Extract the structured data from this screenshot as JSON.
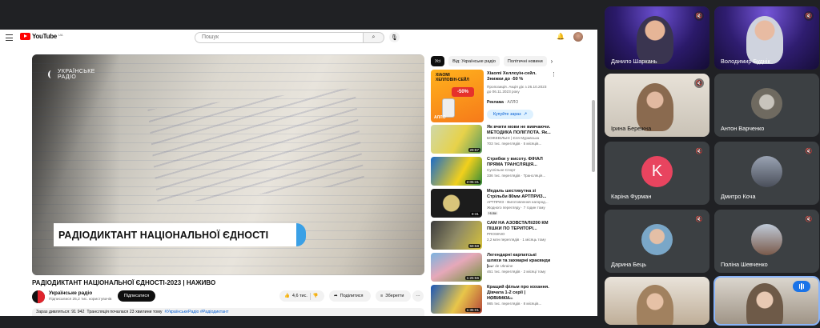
{
  "youtube": {
    "logo_text": "YouTube",
    "logo_country": "UA",
    "search_placeholder": "Пошук",
    "search_icon": "search-icon",
    "mic_icon": "mic-icon",
    "bell_icon": "bell-icon",
    "player": {
      "logo_line1": "УКРАЇНСЬКЕ",
      "logo_line2": "РАДІО",
      "banner": "РАДІОДИКТАНТ НАЦІОНАЛЬНОЇ ЄДНОСТІ"
    },
    "video_title": "РАДІОДИКТАНТ НАЦІОНАЛЬНОЇ ЄДНОСТІ-2023 | НАЖИВО",
    "channel": {
      "name": "Українське радіо",
      "subscribers": "Підписалися 25,2 тис. користувачів",
      "subscribe_label": "Підписатися"
    },
    "actions": {
      "likes": "4,6 тис.",
      "share": "Поділитися",
      "save": "Зберегти",
      "more": "···"
    },
    "description": {
      "watching": "Зараз дивляться: 91 942",
      "started": "Трансляція почалася 23 хвилини тому",
      "tags": "#УкраїнськеРадіо #Радіодиктант"
    },
    "chips": [
      "Усі",
      "Від: Українське радіо",
      "Політичні новини"
    ],
    "ad": {
      "thumb_line1": "XIAOMI",
      "thumb_line2": "ХЕЛЛОВІН-СЕЙЛ",
      "thumb_badge": "-50%",
      "thumb_brand": "АЛЛО",
      "title": "Xiaomi Хеллоуін-сейл. Знижки до -50 %",
      "meta": "Пропозиція. Акція діє з 26.10.2023 до 06.11.2023 року",
      "label_bold": "Реклама",
      "label_src": "· АЛЛО",
      "cta": "Купуйте зараз"
    },
    "recommendations": [
      {
        "title": "Як вчити мови не вивчаючи. МЕТОДИКА ПОЛІГЛОТА. Як...",
        "channel": "БОЖЕВІЛЬНІ | Єля Муравська",
        "meta": "703 тис. переглядів · 5 місяців...",
        "duration": "29:57",
        "badge": ""
      },
      {
        "title": "Стрибки у висоту. ФІНАЛ ПРЯМА ТРАНСЛЯЦІЯ...",
        "channel": "Суспільне Спорт",
        "meta": "336 тис. переглядів · Трансляція...",
        "duration": "2:05:31",
        "badge": ""
      },
      {
        "title": "Медаль шестикутна зі Стрільби 80мм АРТПРИЗ...",
        "channel": "АРТПРИЗ - Виготовлення нагород...",
        "meta": "Жодного перегляду · 7 годин тому",
        "duration": "8:31",
        "badge": "Нове"
      },
      {
        "title": "САМ НА АЗОВСТАЛІ/200 КМ ПІШКИ ПО ТЕРИТОРІ...",
        "channel": "PROSINIO",
        "meta": "2,2 млн переглядів · 1 місяць тому",
        "duration": "59:58",
        "badge": ""
      },
      {
        "title": "Легендарні карпатські шляхи та захмарні краєвиди |...",
        "channel": "Tour de Ukraine",
        "meta": "461 тис. переглядів · 2 місяці тому",
        "duration": "1:25:56",
        "badge": ""
      },
      {
        "title": "Кращий фільм про кохання. Дівчата 1-2 серії | НОВИНКИ...",
        "channel": "Українське кіно",
        "meta": "985 тис. переглядів · 8 місяців...",
        "duration": "1:35:01",
        "badge": ""
      }
    ]
  },
  "meet": {
    "participants": [
      {
        "name": "Данило Шаркань",
        "muted": true,
        "mode": "video"
      },
      {
        "name": "Володимир Буднік",
        "muted": true,
        "mode": "video"
      },
      {
        "name": "Ірина Бережна",
        "muted": true,
        "mode": "video"
      },
      {
        "name": "Антон Варченко",
        "muted": false,
        "mode": "avatar"
      },
      {
        "name": "Каріна Фурман",
        "muted": true,
        "mode": "initial",
        "initial": "K",
        "color": "#e8445f"
      },
      {
        "name": "Дмитро Коча",
        "muted": true,
        "mode": "avatar"
      },
      {
        "name": "Дарина Бець",
        "muted": true,
        "mode": "avatar"
      },
      {
        "name": "Поліна Шевченко",
        "muted": true,
        "mode": "avatar"
      },
      {
        "name": "",
        "muted": true,
        "mode": "video"
      },
      {
        "name": "",
        "muted": false,
        "mode": "video",
        "speaking": true
      }
    ]
  }
}
